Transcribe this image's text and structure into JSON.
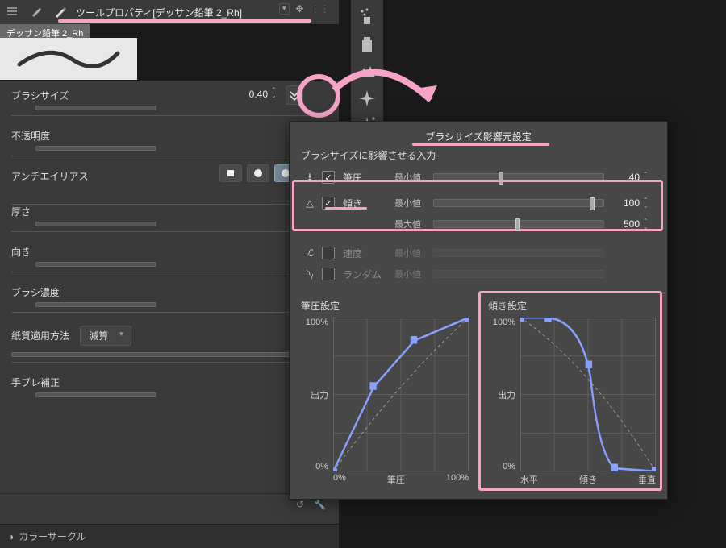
{
  "header": {
    "title": "ツールプロパティ[デッサン鉛筆 2_Rh]",
    "preview_chip": "デッサン鉛筆 2_Rh"
  },
  "props": {
    "brush_size": {
      "label": "ブラシサイズ",
      "value": "0.40"
    },
    "opacity": {
      "label": "不透明度"
    },
    "antialias": {
      "label": "アンチエイリアス"
    },
    "thickness": {
      "label": "厚さ"
    },
    "direction": {
      "label": "向き"
    },
    "density": {
      "label": "ブラシ濃度"
    },
    "paper": {
      "label": "紙質適用方法",
      "value": "減算"
    },
    "stabilize": {
      "label": "手ブレ補正"
    },
    "colorcircle": {
      "label": "カラーサークル"
    }
  },
  "popup": {
    "title": "ブラシサイズ影響元設定",
    "subtitle": "ブラシサイズに影響させる入力",
    "rows": {
      "pressure": {
        "name": "筆圧",
        "checked": true,
        "min_label": "最小値",
        "min_val": "40"
      },
      "tilt": {
        "name": "傾き",
        "checked": true,
        "min_label": "最小値",
        "min_val": "100",
        "max_label": "最大値",
        "max_val": "500"
      },
      "speed": {
        "name": "速度",
        "checked": false,
        "min_label": "最小値"
      },
      "random": {
        "name": "ランダム",
        "checked": false,
        "min_label": "最小値"
      }
    },
    "graph_pressure": {
      "title": "筆圧設定",
      "y100": "100%",
      "ylab": "出力",
      "y0": "0%",
      "x0": "0%",
      "xlab": "筆圧",
      "x1": "100%"
    },
    "graph_tilt": {
      "title": "傾き設定",
      "y100": "100%",
      "ylab": "出力",
      "y0": "0%",
      "x0": "水平",
      "xlab": "傾き",
      "x1": "垂直"
    }
  },
  "chart_data": [
    {
      "type": "line",
      "title": "筆圧設定",
      "xlabel": "筆圧",
      "ylabel": "出力",
      "xlim": [
        0,
        100
      ],
      "ylim": [
        0,
        100
      ],
      "series": [
        {
          "name": "curve",
          "x": [
            0,
            30,
            60,
            100
          ],
          "y": [
            0,
            55,
            85,
            100
          ]
        },
        {
          "name": "default",
          "x": [
            0,
            100
          ],
          "y": [
            0,
            100
          ]
        }
      ]
    },
    {
      "type": "line",
      "title": "傾き設定",
      "xlabel": "傾き",
      "ylabel": "出力",
      "xlim": [
        0,
        100
      ],
      "ylim": [
        0,
        100
      ],
      "x_ticklabels": [
        "水平",
        "傾き",
        "垂直"
      ],
      "series": [
        {
          "name": "curve",
          "x": [
            0,
            20,
            45,
            55,
            70,
            100
          ],
          "y": [
            100,
            100,
            80,
            20,
            2,
            0
          ]
        }
      ]
    }
  ]
}
